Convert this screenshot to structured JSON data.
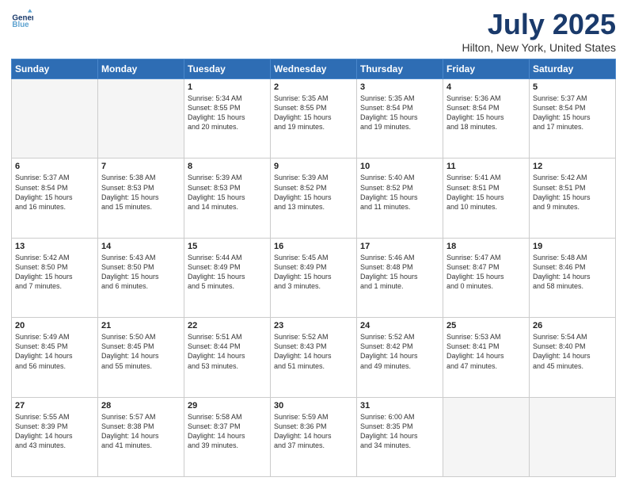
{
  "header": {
    "logo_line1": "General",
    "logo_line2": "Blue",
    "month_title": "July 2025",
    "location": "Hilton, New York, United States"
  },
  "days_of_week": [
    "Sunday",
    "Monday",
    "Tuesday",
    "Wednesday",
    "Thursday",
    "Friday",
    "Saturday"
  ],
  "weeks": [
    [
      {
        "day": "",
        "text": ""
      },
      {
        "day": "",
        "text": ""
      },
      {
        "day": "1",
        "text": "Sunrise: 5:34 AM\nSunset: 8:55 PM\nDaylight: 15 hours\nand 20 minutes."
      },
      {
        "day": "2",
        "text": "Sunrise: 5:35 AM\nSunset: 8:55 PM\nDaylight: 15 hours\nand 19 minutes."
      },
      {
        "day": "3",
        "text": "Sunrise: 5:35 AM\nSunset: 8:54 PM\nDaylight: 15 hours\nand 19 minutes."
      },
      {
        "day": "4",
        "text": "Sunrise: 5:36 AM\nSunset: 8:54 PM\nDaylight: 15 hours\nand 18 minutes."
      },
      {
        "day": "5",
        "text": "Sunrise: 5:37 AM\nSunset: 8:54 PM\nDaylight: 15 hours\nand 17 minutes."
      }
    ],
    [
      {
        "day": "6",
        "text": "Sunrise: 5:37 AM\nSunset: 8:54 PM\nDaylight: 15 hours\nand 16 minutes."
      },
      {
        "day": "7",
        "text": "Sunrise: 5:38 AM\nSunset: 8:53 PM\nDaylight: 15 hours\nand 15 minutes."
      },
      {
        "day": "8",
        "text": "Sunrise: 5:39 AM\nSunset: 8:53 PM\nDaylight: 15 hours\nand 14 minutes."
      },
      {
        "day": "9",
        "text": "Sunrise: 5:39 AM\nSunset: 8:52 PM\nDaylight: 15 hours\nand 13 minutes."
      },
      {
        "day": "10",
        "text": "Sunrise: 5:40 AM\nSunset: 8:52 PM\nDaylight: 15 hours\nand 11 minutes."
      },
      {
        "day": "11",
        "text": "Sunrise: 5:41 AM\nSunset: 8:51 PM\nDaylight: 15 hours\nand 10 minutes."
      },
      {
        "day": "12",
        "text": "Sunrise: 5:42 AM\nSunset: 8:51 PM\nDaylight: 15 hours\nand 9 minutes."
      }
    ],
    [
      {
        "day": "13",
        "text": "Sunrise: 5:42 AM\nSunset: 8:50 PM\nDaylight: 15 hours\nand 7 minutes."
      },
      {
        "day": "14",
        "text": "Sunrise: 5:43 AM\nSunset: 8:50 PM\nDaylight: 15 hours\nand 6 minutes."
      },
      {
        "day": "15",
        "text": "Sunrise: 5:44 AM\nSunset: 8:49 PM\nDaylight: 15 hours\nand 5 minutes."
      },
      {
        "day": "16",
        "text": "Sunrise: 5:45 AM\nSunset: 8:49 PM\nDaylight: 15 hours\nand 3 minutes."
      },
      {
        "day": "17",
        "text": "Sunrise: 5:46 AM\nSunset: 8:48 PM\nDaylight: 15 hours\nand 1 minute."
      },
      {
        "day": "18",
        "text": "Sunrise: 5:47 AM\nSunset: 8:47 PM\nDaylight: 15 hours\nand 0 minutes."
      },
      {
        "day": "19",
        "text": "Sunrise: 5:48 AM\nSunset: 8:46 PM\nDaylight: 14 hours\nand 58 minutes."
      }
    ],
    [
      {
        "day": "20",
        "text": "Sunrise: 5:49 AM\nSunset: 8:45 PM\nDaylight: 14 hours\nand 56 minutes."
      },
      {
        "day": "21",
        "text": "Sunrise: 5:50 AM\nSunset: 8:45 PM\nDaylight: 14 hours\nand 55 minutes."
      },
      {
        "day": "22",
        "text": "Sunrise: 5:51 AM\nSunset: 8:44 PM\nDaylight: 14 hours\nand 53 minutes."
      },
      {
        "day": "23",
        "text": "Sunrise: 5:52 AM\nSunset: 8:43 PM\nDaylight: 14 hours\nand 51 minutes."
      },
      {
        "day": "24",
        "text": "Sunrise: 5:52 AM\nSunset: 8:42 PM\nDaylight: 14 hours\nand 49 minutes."
      },
      {
        "day": "25",
        "text": "Sunrise: 5:53 AM\nSunset: 8:41 PM\nDaylight: 14 hours\nand 47 minutes."
      },
      {
        "day": "26",
        "text": "Sunrise: 5:54 AM\nSunset: 8:40 PM\nDaylight: 14 hours\nand 45 minutes."
      }
    ],
    [
      {
        "day": "27",
        "text": "Sunrise: 5:55 AM\nSunset: 8:39 PM\nDaylight: 14 hours\nand 43 minutes."
      },
      {
        "day": "28",
        "text": "Sunrise: 5:57 AM\nSunset: 8:38 PM\nDaylight: 14 hours\nand 41 minutes."
      },
      {
        "day": "29",
        "text": "Sunrise: 5:58 AM\nSunset: 8:37 PM\nDaylight: 14 hours\nand 39 minutes."
      },
      {
        "day": "30",
        "text": "Sunrise: 5:59 AM\nSunset: 8:36 PM\nDaylight: 14 hours\nand 37 minutes."
      },
      {
        "day": "31",
        "text": "Sunrise: 6:00 AM\nSunset: 8:35 PM\nDaylight: 14 hours\nand 34 minutes."
      },
      {
        "day": "",
        "text": ""
      },
      {
        "day": "",
        "text": ""
      }
    ]
  ]
}
